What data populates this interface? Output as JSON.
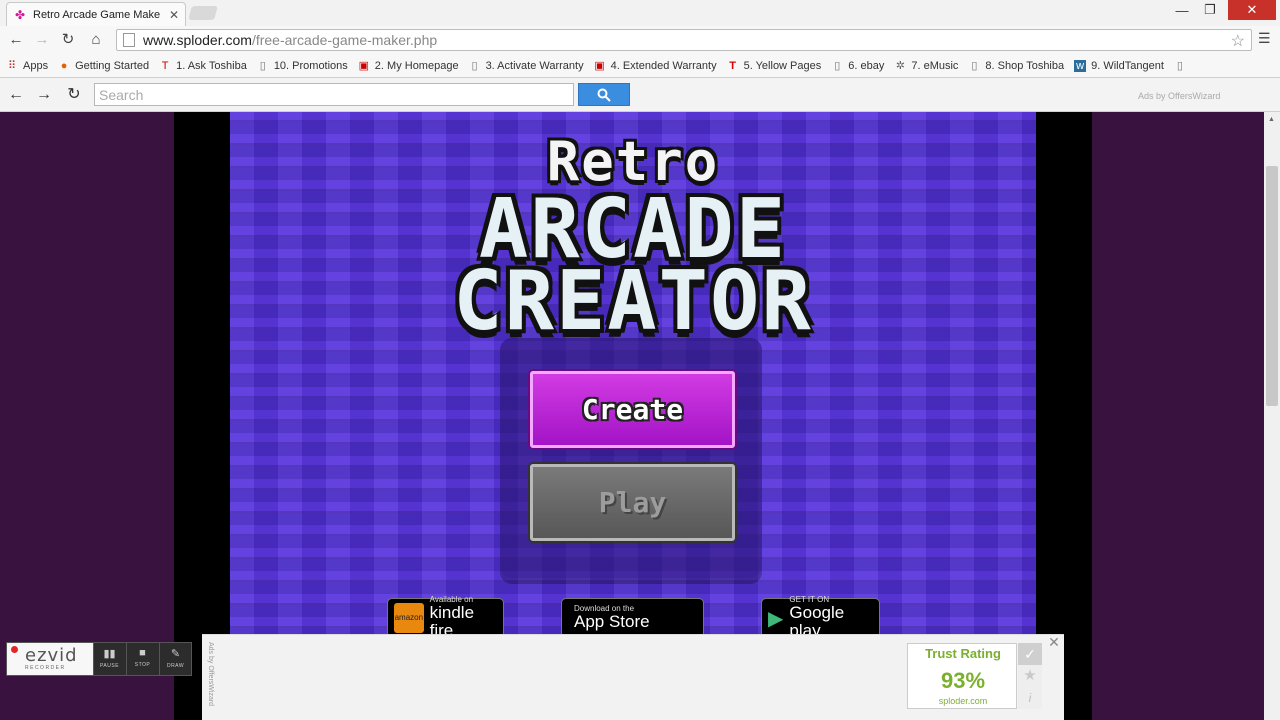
{
  "browser": {
    "tab_title": "Retro Arcade Game Make",
    "url_host": "www.sploder.com",
    "url_path": "/free-arcade-game-maker.php"
  },
  "bookmarks": [
    {
      "label": "Apps",
      "icon": "apps-grid-icon"
    },
    {
      "label": "Getting Started",
      "icon": "firefox-icon"
    },
    {
      "label": "1. Ask Toshiba",
      "icon": "toshiba-icon"
    },
    {
      "label": "10. Promotions",
      "icon": "page-icon"
    },
    {
      "label": "2. My Homepage",
      "icon": "toshiba-icon"
    },
    {
      "label": "3. Activate Warranty",
      "icon": "page-icon"
    },
    {
      "label": "4. Extended Warranty",
      "icon": "toshiba-icon"
    },
    {
      "label": "5. Yellow Pages",
      "icon": "toshiba-t-icon"
    },
    {
      "label": "6. ebay",
      "icon": "page-icon"
    },
    {
      "label": "7. eMusic",
      "icon": "gear-icon"
    },
    {
      "label": "8. Shop Toshiba",
      "icon": "page-icon"
    },
    {
      "label": "9. WildTangent",
      "icon": "wildtangent-icon"
    }
  ],
  "search_toolbar": {
    "placeholder": "Search",
    "ads_text": "Ads by OffersWizard"
  },
  "game": {
    "logo_line1": "Retro",
    "logo_line2": "ARCADE",
    "logo_line3": "CREATOR",
    "create_label": "Create",
    "play_label": "Play",
    "kindle_small": "Available on",
    "kindle_big": "kindle fire",
    "kindle_box": "amazon",
    "apple_small": "Download on the",
    "apple_big": "App Store",
    "google_small": "GET IT ON",
    "google_big": "Google play"
  },
  "ad": {
    "vertical_text": "Ads by OffersWizard",
    "trust_title": "Trust Rating",
    "trust_value": "93%",
    "trust_site": "sploder.com"
  },
  "ezvid": {
    "logo": "ezvid",
    "sub": "RECORDER",
    "pause": "PAUSE",
    "stop": "STOP",
    "draw": "DRAW"
  },
  "colors": {
    "create_button": "#c023d8",
    "background_purple": "#4b2fc9",
    "trust_green": "#7bb02e"
  }
}
